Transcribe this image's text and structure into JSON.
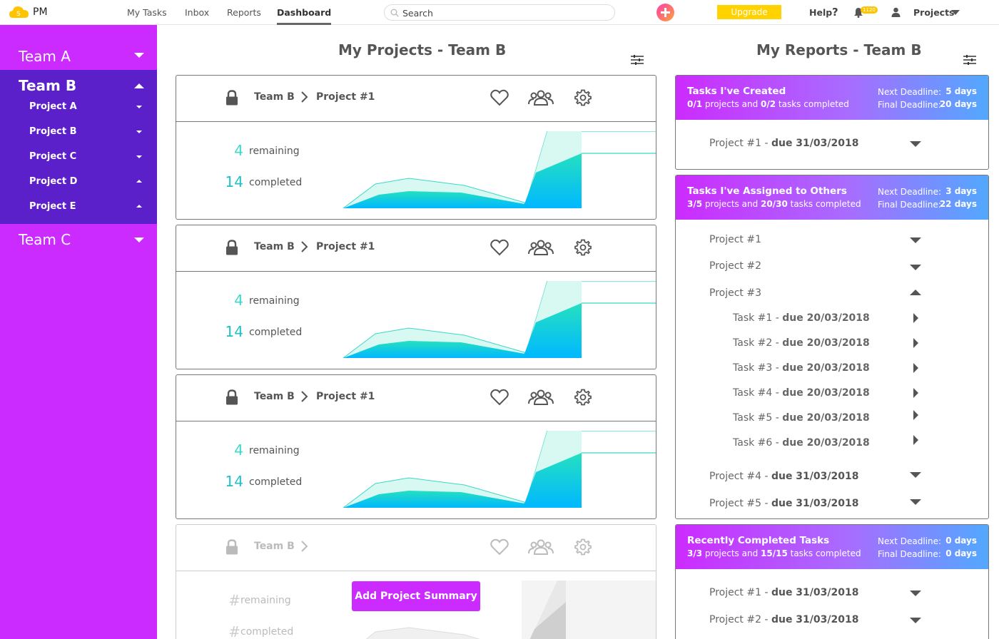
{
  "app": {
    "name": "PM",
    "logo_icon": "cloud-logo-icon"
  },
  "nav": {
    "my_tasks": "My Tasks",
    "inbox": "Inbox",
    "reports": "Reports",
    "dashboard": "Dashboard"
  },
  "search": {
    "placeholder": "Search"
  },
  "topbar": {
    "upgrade": "Upgrade",
    "help": "Help",
    "help_icon": "?",
    "notif_badge": "1120",
    "projects": "Projects"
  },
  "sidebar": {
    "team_a": "Team A",
    "team_b": "Team B",
    "team_c": "Team C",
    "projects": [
      "Project A",
      "Project B",
      "Project C",
      "Project D",
      "Project E"
    ]
  },
  "projects_panel": {
    "title": "My Projects - Team B",
    "cards": [
      {
        "team": "Team B",
        "project": "Project #1",
        "remaining": "4",
        "remaining_label": "remaining",
        "completed": "14",
        "completed_label": "completed"
      },
      {
        "team": "Team B",
        "project": "Project #1",
        "remaining": "4",
        "remaining_label": "remaining",
        "completed": "14",
        "completed_label": "completed"
      },
      {
        "team": "Team B",
        "project": "Project #1",
        "remaining": "4",
        "remaining_label": "remaining",
        "completed": "14",
        "completed_label": "completed"
      }
    ],
    "placeholder_card": {
      "team": "Team B",
      "remaining": "#",
      "remaining_label": "remaining",
      "completed": "#",
      "completed_label": "completed"
    },
    "add_summary": "Add Project Summary"
  },
  "reports_panel": {
    "title": "My Reports - Team B",
    "next_label": "Next Deadline:",
    "final_label": "Final Deadline:",
    "created": {
      "title": "Tasks I've Created",
      "projects_done": "0/1",
      "projects_word": " projects and ",
      "tasks_done": "0/2",
      "tasks_word": " tasks completed",
      "next": "5 days",
      "final": "20 days",
      "items": [
        {
          "name": "Project #1 - ",
          "due": "due 31/03/2018"
        }
      ]
    },
    "assigned": {
      "title": "Tasks I've Assigned to Others",
      "projects_done": "3/5",
      "projects_word": " projects and ",
      "tasks_done": "20/30",
      "tasks_word": " tasks completed",
      "next": "3 days",
      "final": "22 days",
      "projects": [
        "Project #1",
        "Project #2",
        "Project #3"
      ],
      "tasks": [
        {
          "name": "Task #1 - ",
          "due": "due 20/03/2018"
        },
        {
          "name": "Task #2 - ",
          "due": "due 20/03/2018"
        },
        {
          "name": "Task #3 - ",
          "due": "due 20/03/2018"
        },
        {
          "name": "Task #4 - ",
          "due": "due 20/03/2018"
        },
        {
          "name": "Task #5 - ",
          "due": "due 20/03/2018"
        },
        {
          "name": "Task #6 - ",
          "due": "due 20/03/2018"
        }
      ],
      "later": [
        {
          "name": "Project #4 - ",
          "due": "due 31/03/2018"
        },
        {
          "name": "Project #5 - ",
          "due": "due 31/03/2018"
        }
      ]
    },
    "recent": {
      "title": "Recently Completed Tasks",
      "projects_done": "3/3",
      "projects_word": " projects and ",
      "tasks_done": "15/15",
      "tasks_word": " tasks completed",
      "next": "0 days",
      "final": "0 days",
      "items": [
        {
          "name": "Project #1 - ",
          "due": "due 31/03/2018"
        },
        {
          "name": "Project #2 - ",
          "due": "due 31/03/2018"
        }
      ]
    }
  },
  "colors": {
    "sidebar": "#cc2bff",
    "sidebar_active": "#5b20c9",
    "accent_teal": "#20c0c8",
    "upgrade": "#ffd200"
  }
}
